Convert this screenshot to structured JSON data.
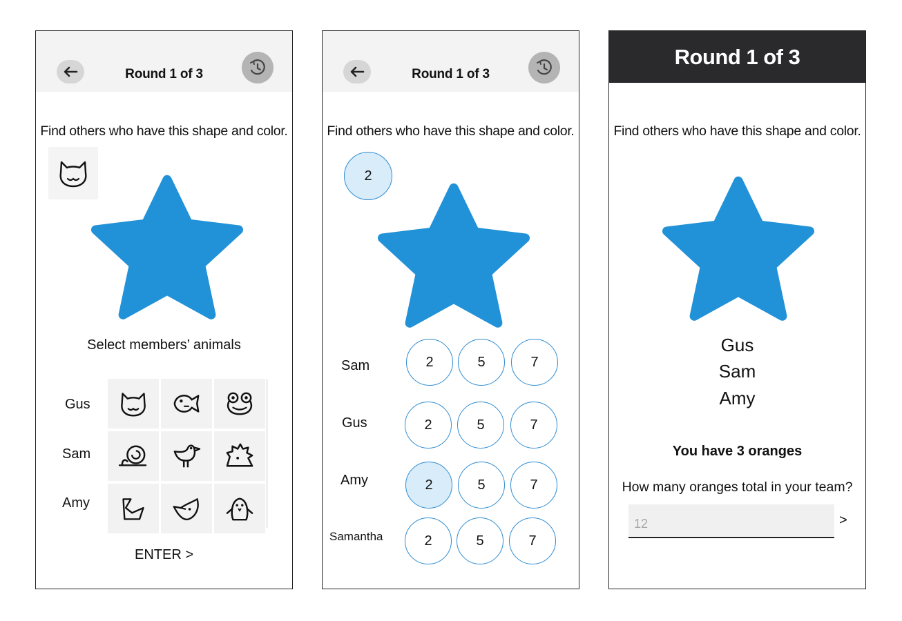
{
  "colors": {
    "star": "#2191d8",
    "accent": "#2d8bd1",
    "selected": "#d9ecfa",
    "header_dark": "#2a2a2c"
  },
  "screen1": {
    "title": "Round 1 of 3",
    "instruction": "Find others who have this shape and color.",
    "shape_icon": "star-icon",
    "my_animal_icon": "cat-icon",
    "select_label": "Select members’ animals",
    "members": [
      {
        "name": "Gus",
        "animals": [
          "cat-icon",
          "fish-icon",
          "frog-icon"
        ]
      },
      {
        "name": "Sam",
        "animals": [
          "snail-icon",
          "bird-icon",
          "hedgehog-icon"
        ]
      },
      {
        "name": "Amy",
        "animals": [
          "duck-icon",
          "rhino-icon",
          "penguin-icon"
        ]
      }
    ],
    "enter_label": "ENTER >"
  },
  "screen2": {
    "title": "Round 1 of 3",
    "instruction": "Find others who have this shape and color.",
    "my_number": "2",
    "rows": [
      {
        "name": "Sam",
        "options": [
          "2",
          "5",
          "7"
        ],
        "selected": null
      },
      {
        "name": "Gus",
        "options": [
          "2",
          "5",
          "7"
        ],
        "selected": null
      },
      {
        "name": "Amy",
        "options": [
          "2",
          "5",
          "7"
        ],
        "selected": "2"
      },
      {
        "name": "Samantha",
        "options": [
          "2",
          "5",
          "7"
        ],
        "selected": null
      }
    ]
  },
  "screen3": {
    "title": "Round 1 of 3",
    "instruction": "Find others who have this shape and color.",
    "members": [
      "Gus",
      "Sam",
      "Amy"
    ],
    "have_text": "You have 3 oranges",
    "question": "How many oranges total in your team?",
    "input_placeholder": "12",
    "input_value": "",
    "submit_label": ">"
  }
}
